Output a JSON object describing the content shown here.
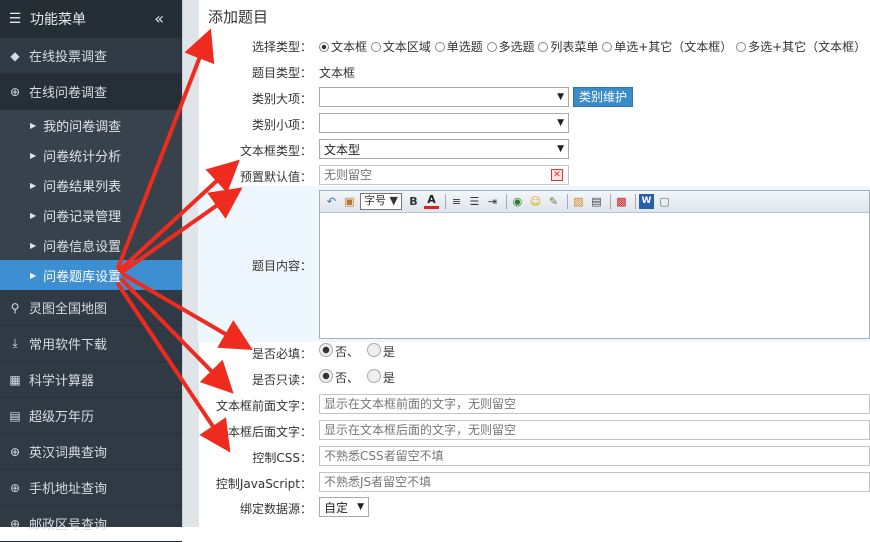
{
  "sidebar": {
    "header": "功能菜单",
    "collapse_icon": "«",
    "items_top": [
      {
        "label": "在线投票调查",
        "icon": "tag-icon"
      },
      {
        "label": "在线问卷调查",
        "icon": "search-plus-icon"
      }
    ],
    "sub_items": [
      {
        "label": "我的问卷调查"
      },
      {
        "label": "问卷统计分析"
      },
      {
        "label": "问卷结果列表"
      },
      {
        "label": "问卷记录管理"
      },
      {
        "label": "问卷信息设置"
      },
      {
        "label": "问卷题库设置",
        "active": true
      }
    ],
    "items_bottom": [
      {
        "label": "灵图全国地图",
        "icon": "map-marker-icon"
      },
      {
        "label": "常用软件下载",
        "icon": "download-icon"
      },
      {
        "label": "科学计算器",
        "icon": "calculator-icon"
      },
      {
        "label": "超级万年历",
        "icon": "calendar-icon"
      },
      {
        "label": "英汉词典查询",
        "icon": "search-plus-icon"
      },
      {
        "label": "手机地址查询",
        "icon": "search-plus-icon"
      },
      {
        "label": "邮政区号查询",
        "icon": "search-plus-icon"
      }
    ]
  },
  "main": {
    "title": "添加题目",
    "choose_type_label": "选择类型：",
    "types": [
      {
        "label": "文本框",
        "checked": true
      },
      {
        "label": "文本区域"
      },
      {
        "label": "单选题"
      },
      {
        "label": "多选题"
      },
      {
        "label": "列表菜单"
      },
      {
        "label": "单选+其它（文本框）"
      },
      {
        "label": "多选+其它（文本框）"
      }
    ],
    "question_type_label": "题目类型：",
    "question_type_value": "文本框",
    "cat_major_label": "类别大项：",
    "cat_major_value": "",
    "cat_maintain_button": "类别维护",
    "cat_minor_label": "类别小项：",
    "cat_minor_value": "",
    "textbox_type_label": "文本框类型：",
    "textbox_type_value": "文本型",
    "default_label": "预置默认值：",
    "default_placeholder": "无则留空",
    "content_label": "题目内容：",
    "editor_font_select": "字号",
    "required_label": "是否必填：",
    "required_no": "否、",
    "required_yes": "是",
    "readonly_label": "是否只读：",
    "readonly_no": "否、",
    "readonly_yes": "是",
    "before_text_label": "文本框前面文字：",
    "before_text_placeholder": "显示在文本框前面的文字，无则留空",
    "after_text_label": "文本框后面文字：",
    "after_text_placeholder": "显示在文本框后面的文字，无则留空",
    "css_label": "控制CSS：",
    "css_placeholder": "不熟悉CSS者留空不填",
    "js_label": "控制JavaScript：",
    "js_placeholder": "不熟悉JS者留空不填",
    "datasource_label": "绑定数据源：",
    "datasource_value": "自定"
  },
  "colors": {
    "sidebar_bg": "#2f3a44",
    "active_item": "#3d8fd1",
    "annotation_arrow": "#ee2b1e"
  }
}
